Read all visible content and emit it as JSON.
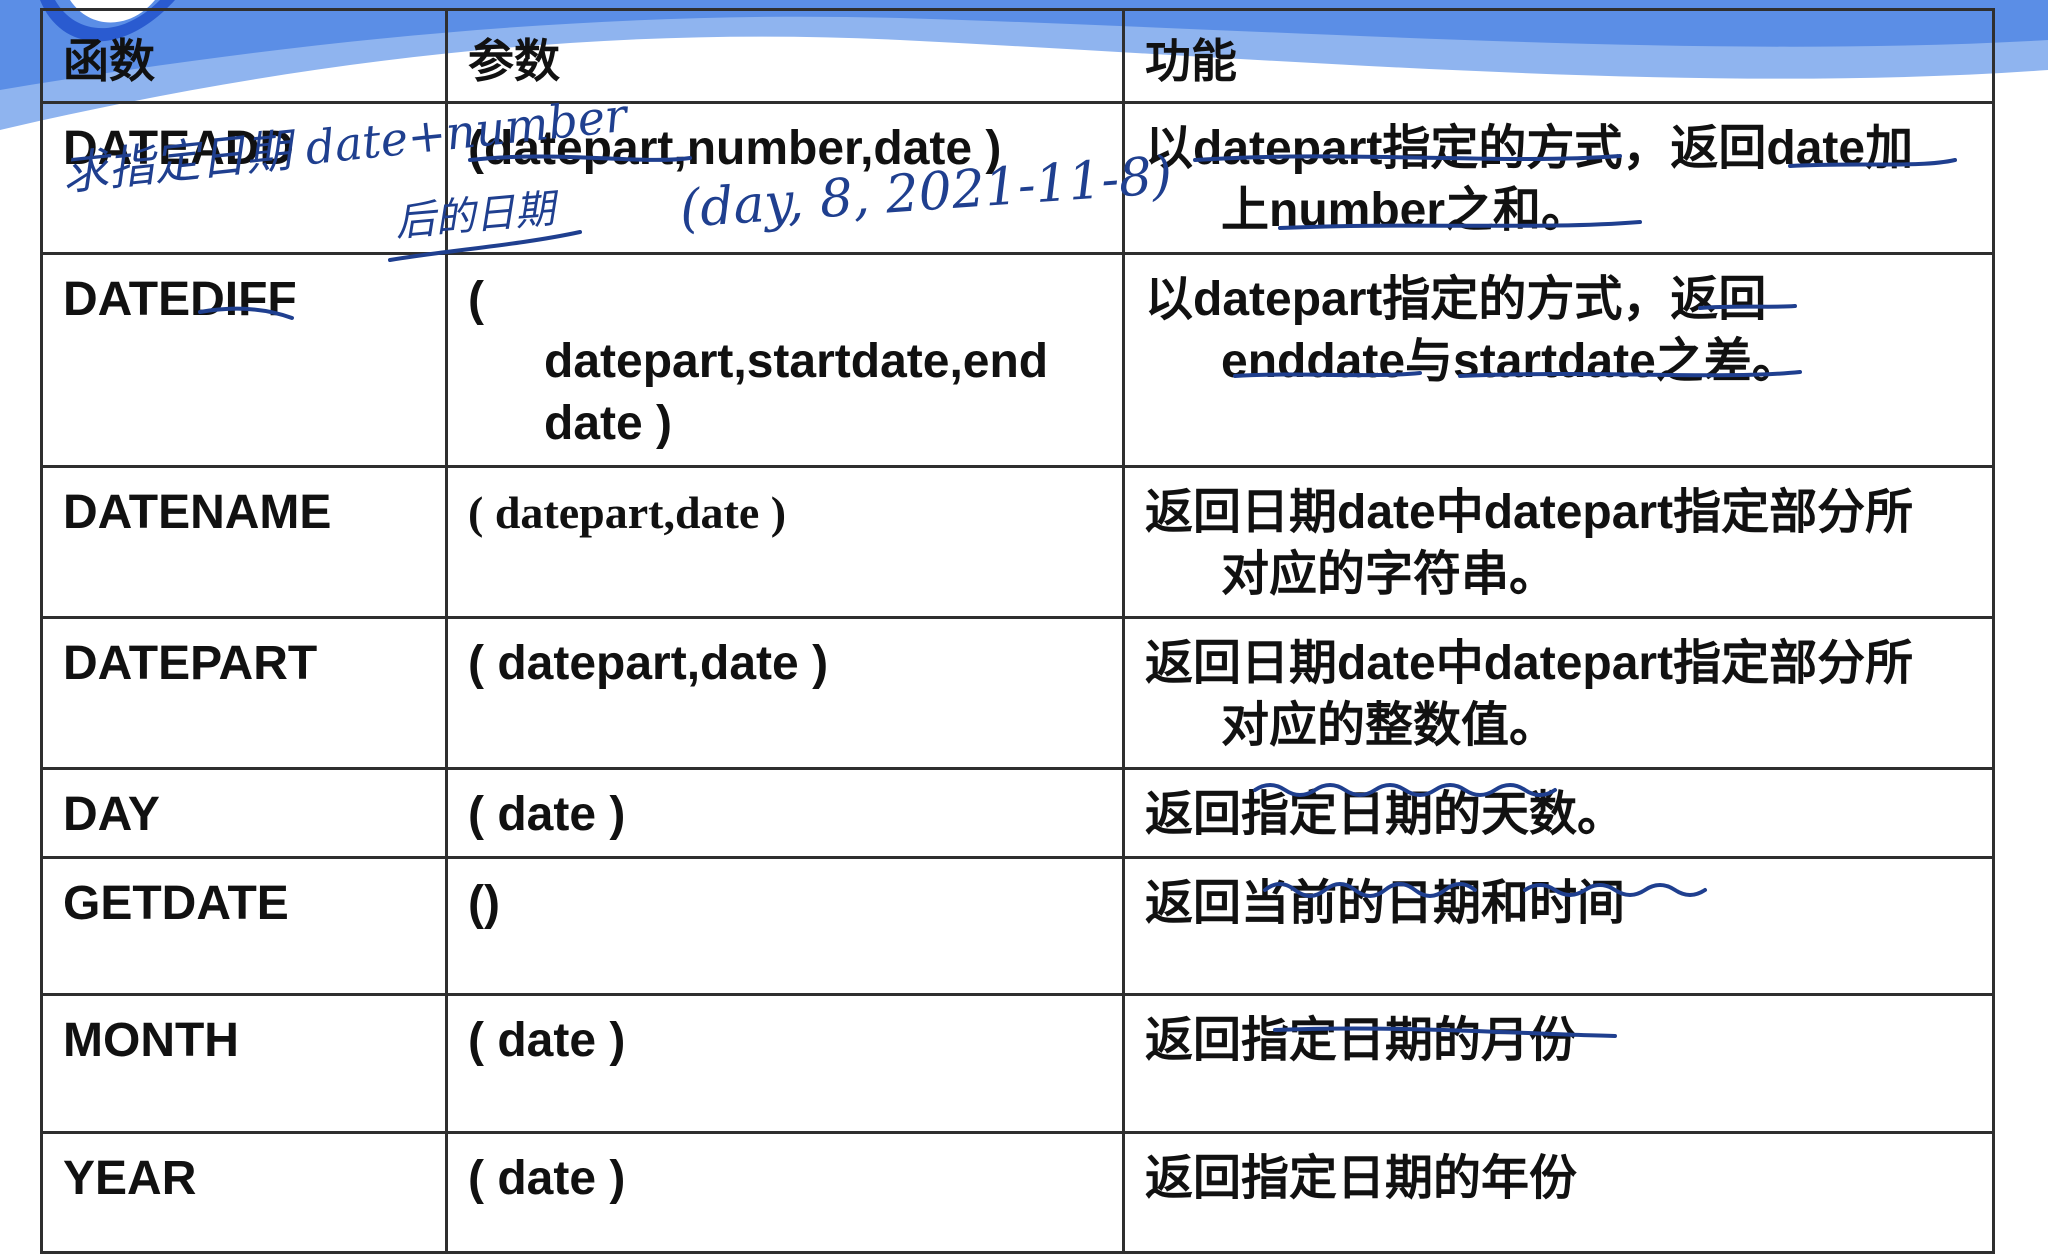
{
  "table": {
    "headers": {
      "function": "函数",
      "params": "参数",
      "purpose": "功能"
    },
    "rows": [
      {
        "name": "DATEADD",
        "params": [
          "(datepart,number,date )"
        ],
        "desc": [
          "以datepart指定的方式，返回date加",
          "上number之和。"
        ]
      },
      {
        "name": "DATEDIFF",
        "params": [
          "(",
          "datepart,startdate,end",
          "date )"
        ],
        "desc": [
          "以datepart指定的方式，返回",
          "enddate与startdate之差。"
        ]
      },
      {
        "name": "DATENAME",
        "params": [
          "(  datepart,date  )"
        ],
        "desc": [
          "返回日期date中datepart指定部分所",
          "对应的字符串。"
        ]
      },
      {
        "name": "DATEPART",
        "params": [
          "( datepart,date )"
        ],
        "desc": [
          "返回日期date中datepart指定部分所",
          "对应的整数值。"
        ]
      },
      {
        "name": "DAY",
        "params": [
          "( date )"
        ],
        "desc": [
          "返回指定日期的天数。"
        ]
      },
      {
        "name": "GETDATE",
        "params": [
          "()"
        ],
        "desc": [
          "返回当前的日期和时间"
        ]
      },
      {
        "name": "MONTH",
        "params": [
          "( date )"
        ],
        "desc": [
          "返回指定日期的月份"
        ]
      },
      {
        "name": "YEAR",
        "params": [
          "( date )"
        ],
        "desc": [
          "返回指定日期的年份"
        ]
      }
    ]
  },
  "annotations": {
    "note_main": "求指定日期 date+number",
    "note_sub": "后的日期",
    "example": "(day, 8, 2021-11-8)"
  },
  "colors": {
    "ink": "#1f3f8f",
    "header_band": "#5b8ee6",
    "grid": "#2f2f2f"
  }
}
